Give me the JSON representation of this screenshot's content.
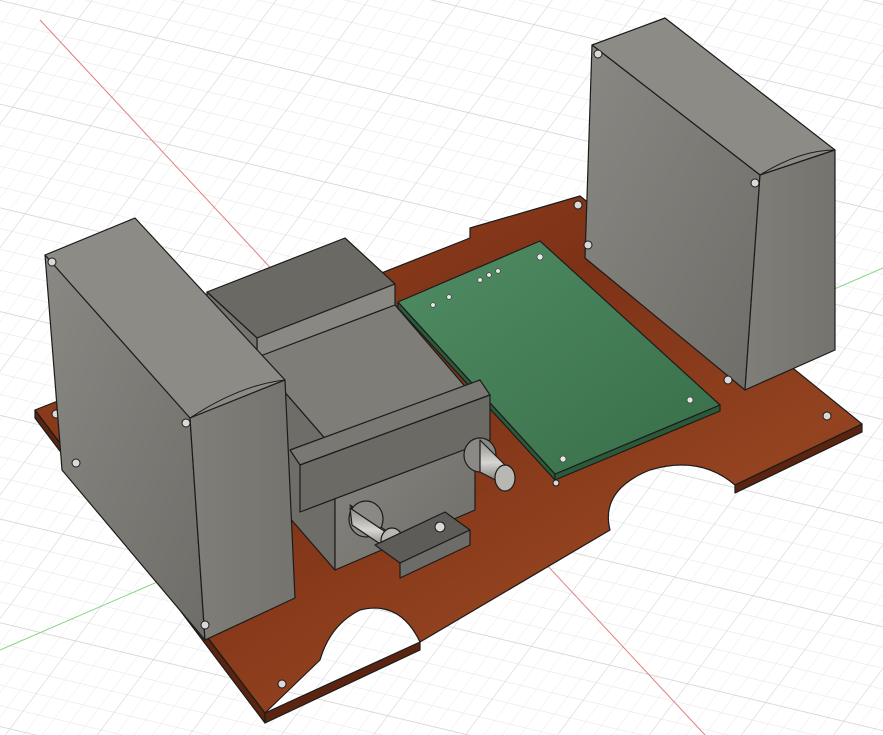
{
  "viewport": {
    "background": "#ffffff",
    "grid_color": "#e3e3e3",
    "grid_major_color": "#cfcfcf",
    "axis_x_color": "#e08080",
    "axis_y_color": "#86d486"
  },
  "model": {
    "base_plate": {
      "material": "wood",
      "color": "#8a3b1c"
    },
    "enclosures": [
      {
        "name": "left-enclosure",
        "color": "#7a7872"
      },
      {
        "name": "right-enclosure",
        "color": "#7a7872"
      }
    ],
    "pcb": {
      "color": "#3f7a52"
    },
    "motor_assembly": {
      "color": "#74726d"
    }
  }
}
